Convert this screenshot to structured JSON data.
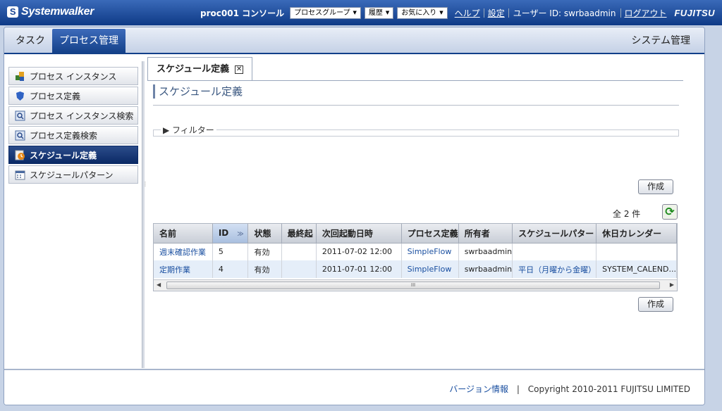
{
  "header": {
    "logo": "Systemwalker",
    "console": "proc001 コンソール",
    "process_group_select": "プロセスグループ",
    "history_select": "履歴",
    "favorites_select": "お気に入り",
    "help_link": "ヘルプ",
    "settings_link": "設定",
    "user_label": "ユーザー ID: swrbaadmin",
    "logout_link": "ログアウト",
    "brand": "FUJITSU"
  },
  "top_tabs": {
    "task": "タスク",
    "process_mgmt": "プロセス管理",
    "system_mgmt": "システム管理"
  },
  "sidebar": {
    "items": [
      {
        "label": "プロセス インスタンス",
        "icon": "process-instance-icon"
      },
      {
        "label": "プロセス定義",
        "icon": "shield-icon"
      },
      {
        "label": "プロセス インスタンス検索",
        "icon": "search-window-icon"
      },
      {
        "label": "プロセス定義検索",
        "icon": "search-window-icon"
      },
      {
        "label": "スケジュール定義",
        "icon": "schedule-clock-icon"
      },
      {
        "label": "スケジュールパターン",
        "icon": "calendar-icon"
      }
    ]
  },
  "content_tab": {
    "label": "スケジュール定義",
    "close": "✕"
  },
  "page_title": "スケジュール定義",
  "filter": {
    "label": "▶ フィルター"
  },
  "buttons": {
    "create_top": "作成",
    "create_bottom": "作成"
  },
  "count_text": "全 2 件",
  "table": {
    "columns": [
      "名前",
      "ID",
      "状態",
      "最終起",
      "次回起動日時",
      "プロセス定義",
      "所有者",
      "スケジュールパター",
      "休日カレンダー"
    ],
    "rows": [
      [
        "週末確認作業",
        "5",
        "有効",
        "",
        "2011-07-02 12:00",
        "SimpleFlow",
        "swrbaadmin",
        "",
        ""
      ],
      [
        "定期作業",
        "4",
        "有効",
        "",
        "2011-07-01 12:00",
        "SimpleFlow",
        "swrbaadmin",
        "平日（月曜から金曜）",
        "SYSTEM_CALEND..."
      ]
    ]
  },
  "scrollbar_grip": "III",
  "footer": {
    "version_link": "バージョン情報",
    "separator": "|",
    "copyright": "Copyright 2010-2011 FUJITSU LIMITED"
  },
  "colors": {
    "header_bg": "#0e3a86",
    "active_tab": "#123f86",
    "link": "#1a4fa0",
    "sidebar_active": "#0b2a66"
  }
}
